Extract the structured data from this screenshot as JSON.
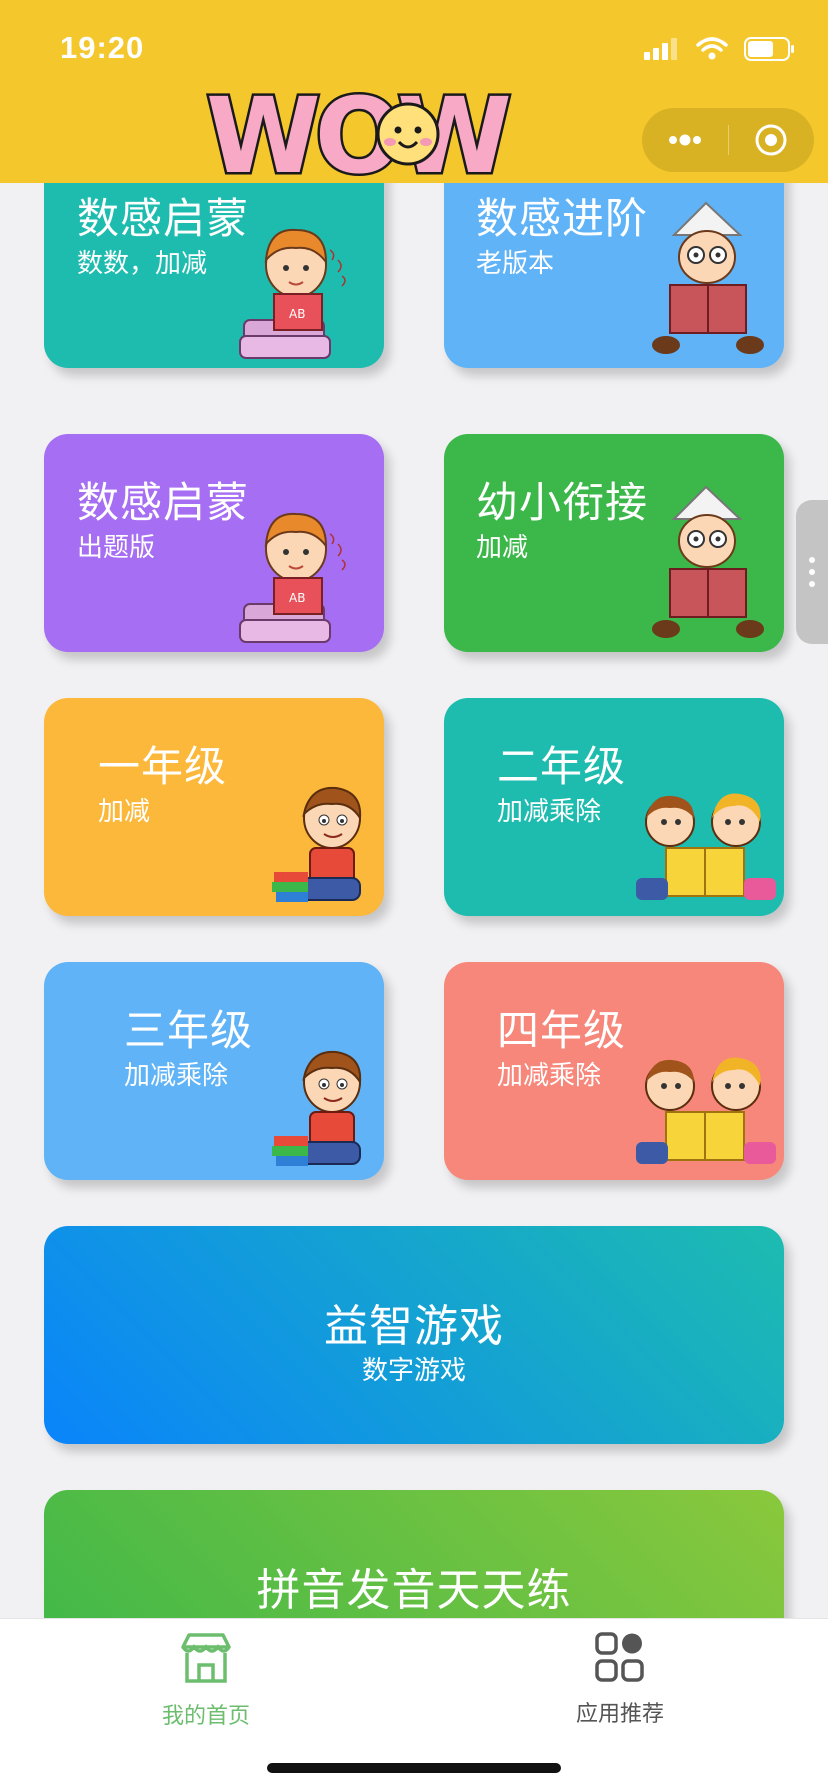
{
  "status_bar": {
    "time": "19:20"
  },
  "header": {
    "logo_text": "WOW"
  },
  "cards": [
    {
      "title": "数感启蒙",
      "subtitle": "数数，加减",
      "color": "#1dbcaf",
      "art": "child-reading-book"
    },
    {
      "title": "数感进阶",
      "subtitle": "老版本",
      "color": "#5fb3f6",
      "art": "boy-paper-hat-reading"
    },
    {
      "title": "数感启蒙",
      "subtitle": "出题版",
      "color": "#a66ef2",
      "art": "child-reading-book"
    },
    {
      "title": "幼小衔接",
      "subtitle": "加减",
      "color": "#3cb74a",
      "art": "boy-paper-hat-reading"
    },
    {
      "title": "一年级",
      "subtitle": "加减",
      "color": "#fbb83a",
      "art": "boy-with-books"
    },
    {
      "title": "二年级",
      "subtitle": "加减乘除",
      "color": "#1dbcaf",
      "art": "kids-reading-together"
    },
    {
      "title": "三年级",
      "subtitle": "加减乘除",
      "color": "#5fb3f6",
      "art": "boy-with-books"
    },
    {
      "title": "四年级",
      "subtitle": "加减乘除",
      "color": "#f7877a",
      "art": "kids-reading-together"
    }
  ],
  "wide_cards": [
    {
      "title": "益智游戏",
      "subtitle": "数字游戏",
      "color_start": "#0a84fb",
      "color_end": "#1dbcaf"
    },
    {
      "title": "拼音发音天天练",
      "subtitle": "",
      "color_start": "#3cb74a",
      "color_end": "#8ac83c"
    }
  ],
  "tabbar": {
    "items": [
      {
        "label": "我的首页",
        "icon": "storefront-icon",
        "active": true,
        "color": "#6cbd6e"
      },
      {
        "label": "应用推荐",
        "icon": "grid-apps-icon",
        "active": false,
        "color": "#555555"
      }
    ]
  }
}
